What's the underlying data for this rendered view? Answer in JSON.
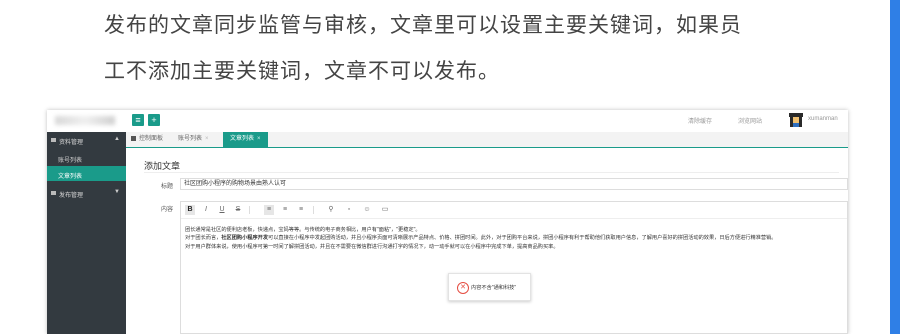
{
  "caption": {
    "line1": "发布的文章同步监管与审核，文章里可以设置主要关键词，如果员",
    "line2": "工不添加主要关键词，文章不可以发布。"
  },
  "header": {
    "btn_menu_icon": "≡",
    "btn_add_icon": "+",
    "clear_cache": "清除缓存",
    "browse_site": "浏览网站",
    "username": "xumanman"
  },
  "sidebar": {
    "group1": "资料管理",
    "group1_items": [
      "账号列表",
      "文章列表"
    ],
    "group2": "发布管理"
  },
  "tabs": [
    {
      "label": "控制面板"
    },
    {
      "label": "账号列表"
    },
    {
      "label": "文章列表"
    }
  ],
  "form": {
    "page_title": "添加文章",
    "title_label": "标题",
    "title_value": "社区团购小程序的购物场景由熟人认可",
    "content_label": "内容"
  },
  "toolbar": {
    "bold": "B",
    "italic": "I",
    "underline": "U",
    "strike": "S"
  },
  "content": {
    "p1": "团长通常是社区的便利店老板，快递点，宝妈等等。与传统的电子商务相比，用户有\"面粘\"，\"更稳定\"。",
    "p2_a": "对于团长而言，",
    "p2_bold": "社区团购小程序开发",
    "p2_b": "可以直接在小程序中发起团购活动，并且小程序页面可清晰展示产品特点、价格、拼团时间。此外，对于团购平台来说，拼团小程序有利于帮助他们获取用户信息，了解用户喜好的拼团活动的效果，日后方便进行精准营销。",
    "p3": "对于用户群体来说，使用小程序可第一时间了解拼团活动，并且在不需要在微信群进行沟通打字的情况下，动一动手就可以在小程序中完成下单，提高商品购买率。"
  },
  "toast": {
    "message": "内容不含\"通和科技\""
  },
  "colors": {
    "accent": "#1a9b8a",
    "sidebar_bg": "#333a40",
    "edge_bar": "#2f7fe6",
    "error": "#e54d42"
  }
}
